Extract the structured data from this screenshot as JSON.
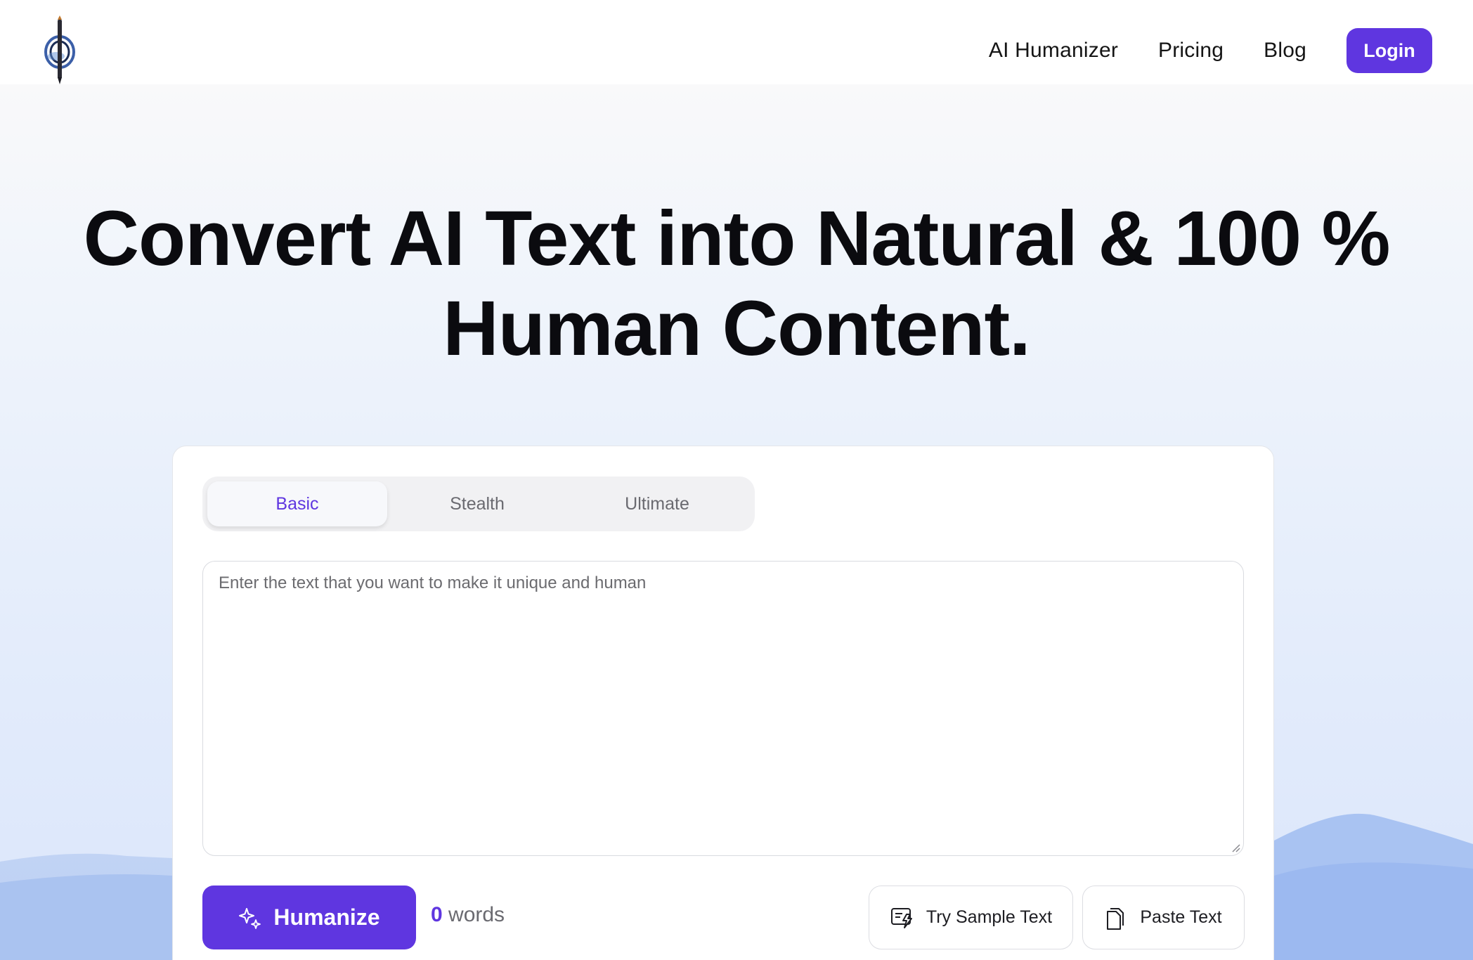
{
  "header": {
    "logo_icon": "pen-compass-logo-icon",
    "nav": [
      {
        "label": "AI Humanizer"
      },
      {
        "label": "Pricing"
      },
      {
        "label": "Blog"
      }
    ],
    "login_label": "Login"
  },
  "hero": {
    "line1": "Convert AI Text into Natural & 100 %",
    "line2": "Human Content."
  },
  "tool": {
    "tabs": [
      {
        "label": "Basic",
        "active": true
      },
      {
        "label": "Stealth",
        "active": false
      },
      {
        "label": "Ultimate",
        "active": false
      }
    ],
    "input_placeholder": "Enter the text that you want to make it unique and human",
    "input_value": "",
    "humanize_label": "Humanize",
    "word_count": "0",
    "word_unit": "words",
    "sample_label": "Try Sample Text",
    "paste_label": "Paste Text"
  },
  "colors": {
    "accent": "#5f36e0",
    "text": "#0b0b0f",
    "muted": "#6a6a70",
    "background_sky": "#dbe6fb"
  }
}
